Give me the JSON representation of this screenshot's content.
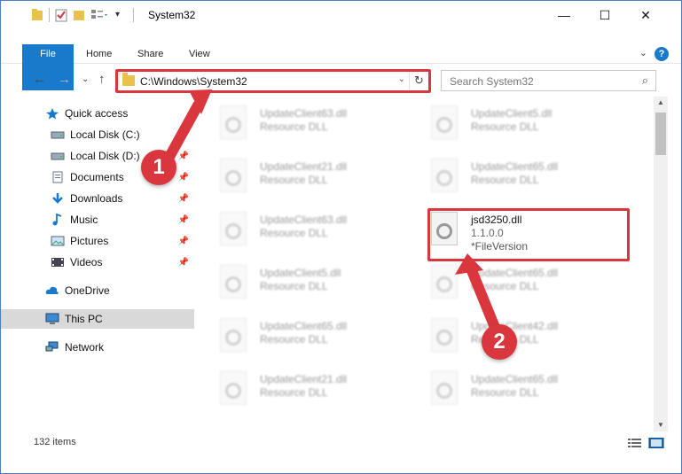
{
  "window": {
    "title": "System32",
    "controls": {
      "minimize": "—",
      "maximize": "☐",
      "close": "✕"
    }
  },
  "ribbon": {
    "tabs": [
      "File",
      "Home",
      "Share",
      "View"
    ]
  },
  "address_bar": {
    "path": "C:\\Windows\\System32"
  },
  "search": {
    "placeholder": "Search System32"
  },
  "sidebar": {
    "items": [
      {
        "label": "Quick access",
        "icon": "star-icon",
        "pinned": false
      },
      {
        "label": "Local Disk (C:)",
        "icon": "drive-icon",
        "pinned": true
      },
      {
        "label": "Local Disk (D:)",
        "icon": "drive-icon",
        "pinned": true
      },
      {
        "label": "Documents",
        "icon": "documents-icon",
        "pinned": true
      },
      {
        "label": "Downloads",
        "icon": "download-icon",
        "pinned": true
      },
      {
        "label": "Music",
        "icon": "music-icon",
        "pinned": true
      },
      {
        "label": "Pictures",
        "icon": "pictures-icon",
        "pinned": true
      },
      {
        "label": "Videos",
        "icon": "videos-icon",
        "pinned": true
      },
      {
        "label": "OneDrive",
        "icon": "cloud-icon",
        "pinned": false
      },
      {
        "label": "This PC",
        "icon": "computer-icon",
        "pinned": false,
        "selected": true
      },
      {
        "label": "Network",
        "icon": "network-icon",
        "pinned": false
      }
    ]
  },
  "files": [
    {
      "name": "UpdateClient63.dll",
      "type": "Resource DLL",
      "blurred": true
    },
    {
      "name": "UpdateClient5.dll",
      "type": "Resource DLL",
      "blurred": true
    },
    {
      "name": "UpdateClient21.dll",
      "type": "Resource DLL",
      "blurred": true
    },
    {
      "name": "UpdateClient65.dll",
      "type": "Resource DLL",
      "blurred": true
    },
    {
      "name": "UpdateClient63.dll",
      "type": "Resource DLL",
      "blurred": true
    },
    {
      "name": "jsd3250.dll",
      "type": "1.1.0.0",
      "extra": "*FileVersion",
      "blurred": false
    },
    {
      "name": "UpdateClient5.dll",
      "type": "Resource DLL",
      "blurred": true
    },
    {
      "name": "UpdateClient65.dll",
      "type": "Resource DLL",
      "blurred": true
    },
    {
      "name": "UpdateClient65.dll",
      "type": "Resource DLL",
      "blurred": true
    },
    {
      "name": "UpdateClient42.dll",
      "type": "Resource DLL",
      "blurred": true
    },
    {
      "name": "UpdateClient21.dll",
      "type": "Resource DLL",
      "blurred": true
    },
    {
      "name": "UpdateClient65.dll",
      "type": "Resource DLL",
      "blurred": true
    }
  ],
  "status_bar": {
    "item_count": "132 items"
  },
  "annotations": [
    {
      "label": "1"
    },
    {
      "label": "2"
    }
  ],
  "colors": {
    "accent": "#1979ca",
    "highlight_red": "#d9363e",
    "folder": "#e8c24a"
  }
}
